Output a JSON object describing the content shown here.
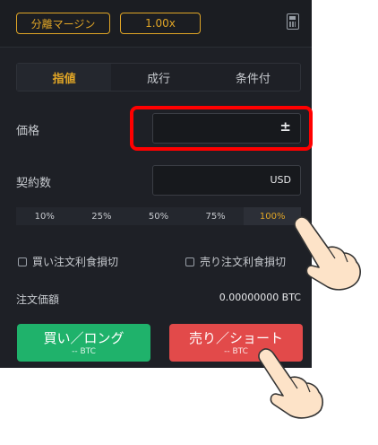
{
  "topbar": {
    "margin_mode": "分離マージン",
    "leverage": "1.00x",
    "calculator_icon": "calculator-icon"
  },
  "order_tabs": [
    {
      "label": "指値",
      "active": true
    },
    {
      "label": "成行",
      "active": false
    },
    {
      "label": "条件付",
      "active": false
    }
  ],
  "price": {
    "label": "価格",
    "value": "",
    "adjust_icon": "plus-minus-icon"
  },
  "quantity": {
    "label": "契約数",
    "unit": "USD"
  },
  "percent_options": [
    {
      "label": "10%",
      "active": false
    },
    {
      "label": "25%",
      "active": false
    },
    {
      "label": "50%",
      "active": false
    },
    {
      "label": "75%",
      "active": false
    },
    {
      "label": "100%",
      "active": true
    }
  ],
  "checkboxes": {
    "buy_tp_sl": "買い注文利食損切",
    "sell_tp_sl": "売り注文利食損切"
  },
  "order_value": {
    "label": "注文価額",
    "value": "0.00000000 BTC"
  },
  "buttons": {
    "buy": {
      "label": "買い／ロング",
      "sub": "-- BTC"
    },
    "sell": {
      "label": "売り／ショート",
      "sub": "-- BTC"
    }
  },
  "colors": {
    "accent": "#e0a526",
    "buy": "#1fb26b",
    "sell": "#e24a4a",
    "highlight": "#ff0000"
  }
}
